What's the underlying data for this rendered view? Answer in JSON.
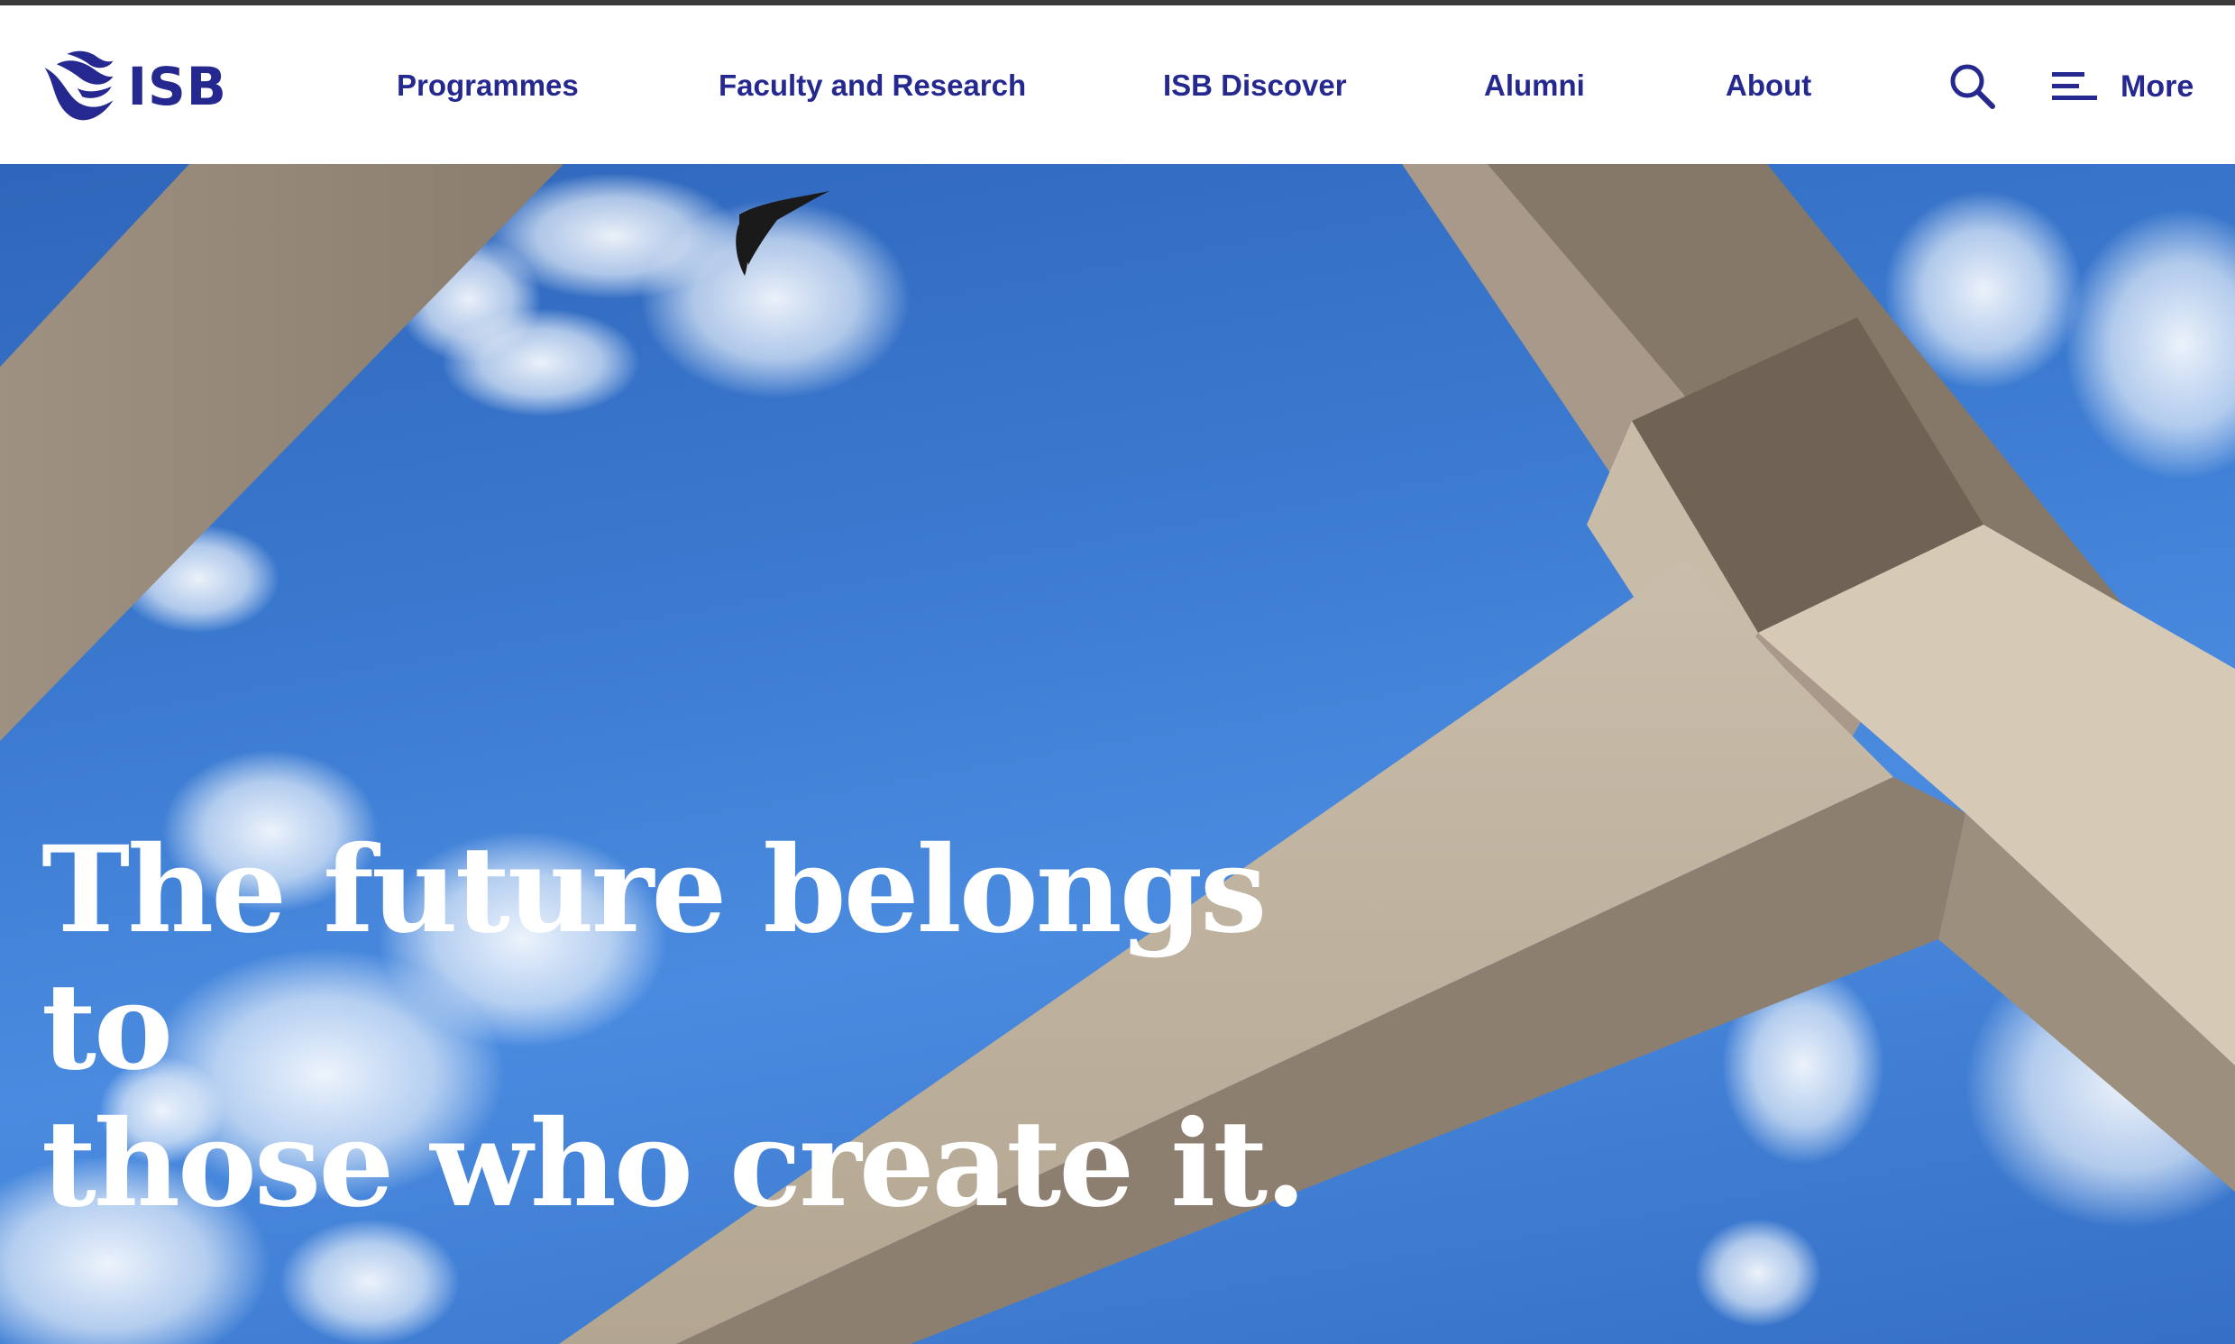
{
  "brand": {
    "logo_text": "ISB",
    "color": "#24288f"
  },
  "nav": {
    "items": [
      {
        "label": "Programmes"
      },
      {
        "label": "Faculty and Research"
      },
      {
        "label": "ISB Discover"
      },
      {
        "label": "Alumni"
      },
      {
        "label": "About"
      }
    ],
    "search_icon": "search-icon",
    "menu_icon": "hamburger-icon",
    "more_label": "More"
  },
  "hero": {
    "heading_line1": "The future belongs to",
    "heading_line2": "those who create it.",
    "sky_color": "#3b7ad0",
    "beam_color": "#b8ab98"
  }
}
